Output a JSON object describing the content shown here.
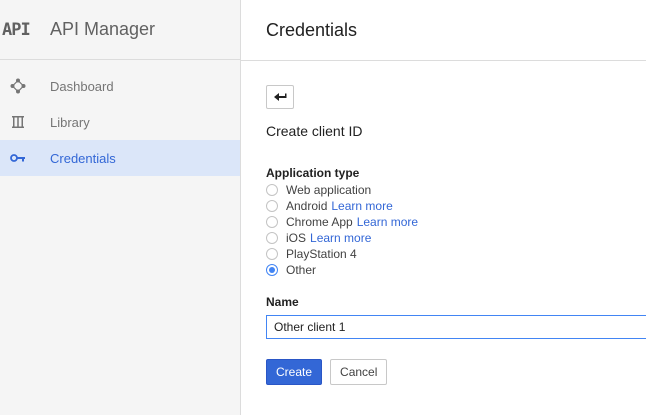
{
  "sidebar": {
    "logo": "API",
    "title": "API Manager",
    "items": [
      {
        "label": "Dashboard",
        "icon": "dashboard-icon",
        "active": false
      },
      {
        "label": "Library",
        "icon": "library-icon",
        "active": false
      },
      {
        "label": "Credentials",
        "icon": "key-icon",
        "active": true
      }
    ]
  },
  "header": {
    "title": "Credentials"
  },
  "form": {
    "subtitle": "Create client ID",
    "app_type_label": "Application type",
    "options": [
      {
        "label": "Web application",
        "link": "",
        "checked": false
      },
      {
        "label": "Android",
        "link": "Learn more",
        "checked": false
      },
      {
        "label": "Chrome App",
        "link": "Learn more",
        "checked": false
      },
      {
        "label": "iOS",
        "link": "Learn more",
        "checked": false
      },
      {
        "label": "PlayStation 4",
        "link": "",
        "checked": false
      },
      {
        "label": "Other",
        "link": "",
        "checked": true
      }
    ],
    "name_label": "Name",
    "name_value": "Other client 1",
    "create_label": "Create",
    "cancel_label": "Cancel"
  },
  "colors": {
    "accent": "#3367d6",
    "radio": "#4285f4",
    "active_bg": "#dbe6f9"
  }
}
